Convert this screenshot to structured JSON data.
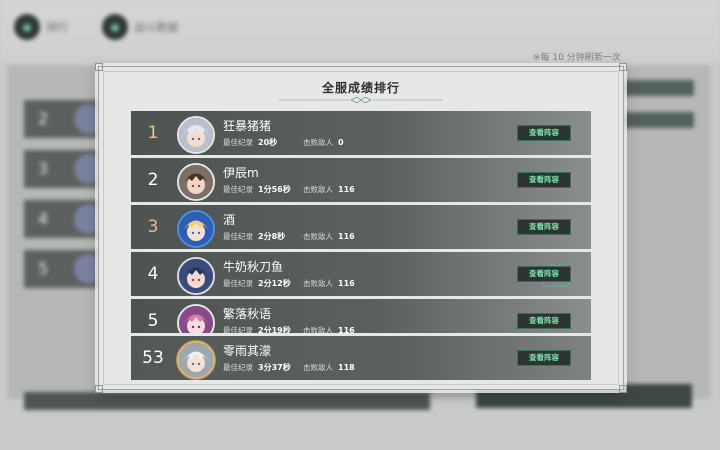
{
  "background": {
    "tabs": [
      {
        "icon": "diamond-icon",
        "label": "排行"
      },
      {
        "icon": "diamond-icon",
        "label": "战斗数据"
      }
    ],
    "side_rows": [
      "2",
      "3",
      "4",
      "5"
    ],
    "refresh_note": "※每 10 分钟刷新一次"
  },
  "modal": {
    "title": "全服成绩排行",
    "record_label": "最佳纪录",
    "defeated_label": "击败敌人",
    "view_button_label": "查看阵容",
    "rows": [
      {
        "rank": "1",
        "name": "狂暴猪猪",
        "record": "20秒",
        "defeated": "0",
        "rank_color": "#f2c682",
        "avatar": "silver-hair-avatar"
      },
      {
        "rank": "2",
        "name": "伊辰m",
        "record": "1分56秒",
        "defeated": "116",
        "rank_color": "#ffffff",
        "avatar": "brown-hair-avatar"
      },
      {
        "rank": "3",
        "name": "酒",
        "record": "2分8秒",
        "defeated": "116",
        "rank_color": "#efb89a",
        "avatar": "blonde-hair-avatar"
      },
      {
        "rank": "4",
        "name": "牛奶秋刀鱼",
        "record": "2分12秒",
        "defeated": "116",
        "rank_color": "#ffffff",
        "avatar": "dark-hair-avatar"
      },
      {
        "rank": "5",
        "name": "繁落秋语",
        "record": "2分19秒",
        "defeated": "116",
        "rank_color": "#ffffff",
        "avatar": "pink-hair-avatar"
      }
    ],
    "self_row": {
      "rank": "53",
      "name": "零雨其濛",
      "record": "3分37秒",
      "defeated": "118",
      "rank_color": "#ffffff",
      "avatar": "white-hair-avatar"
    }
  }
}
